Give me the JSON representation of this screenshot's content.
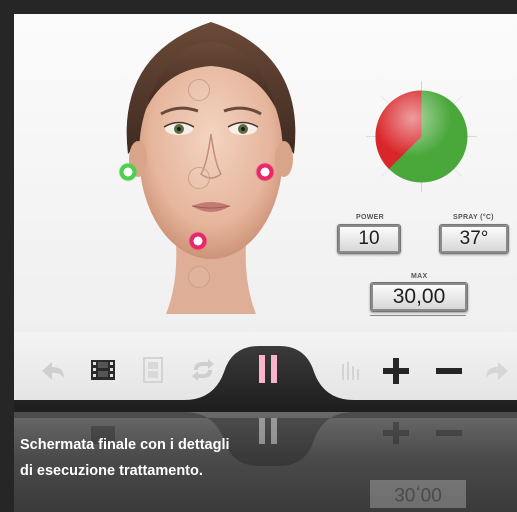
{
  "colors": {
    "background": "#262626",
    "accent_green": "#4fcf50",
    "accent_pink": "#e8286b",
    "pie_red": "#d9262a",
    "pie_green": "#4aa83b"
  },
  "panel": {
    "power_label": "POWER",
    "power_value": "10",
    "temp_label": "SPRAY (°C)",
    "temp_value": "37°",
    "time_label": "MAX",
    "time_value": "30,00"
  },
  "toolbar": {
    "icons": [
      "back-arrow-icon",
      "film-icon",
      "film-faded-icon",
      "repeat-icon",
      "pause-icon",
      "grip-icon",
      "plus-icon",
      "minus-icon",
      "forward-arrow-icon"
    ]
  },
  "reflection": {
    "time_value": "30,00"
  },
  "caption": {
    "line1": "Schermata finale con i dettagli",
    "line2": "di esecuzione trattamento."
  }
}
